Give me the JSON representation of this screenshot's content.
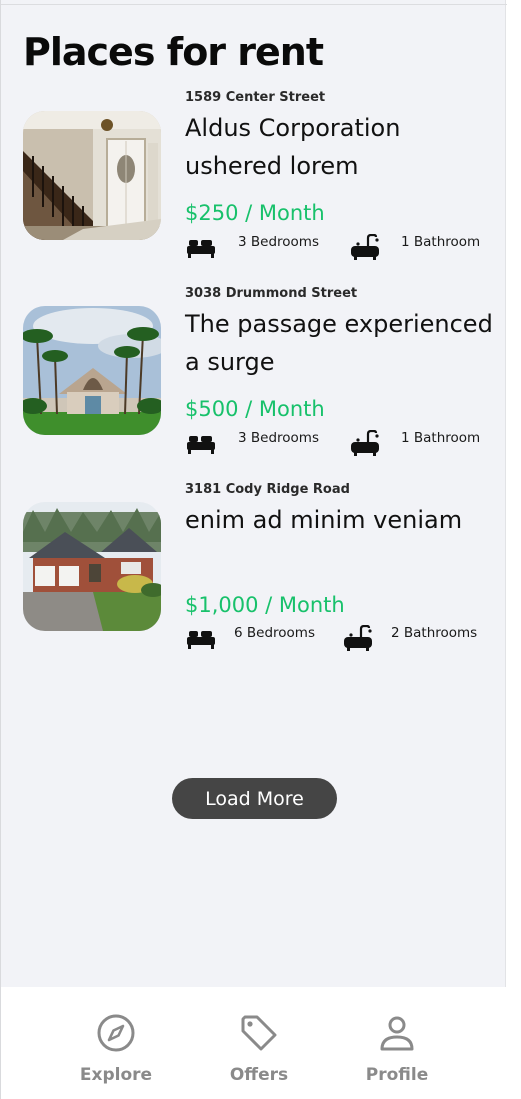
{
  "page": {
    "title": "Places for rent"
  },
  "listings": [
    {
      "address": "1589 Center Street",
      "name": "Aldus Corporation ushered lorem",
      "price": "$250 / Month",
      "bedrooms": "3 Bedrooms",
      "bathrooms": "1 Bathroom",
      "image": "house-interior-staircase-photo"
    },
    {
      "address": "3038 Drummond Street",
      "name": "The passage experienced a surge",
      "price": "$500 / Month",
      "bedrooms": "3 Bedrooms",
      "bathrooms": "1 Bathroom",
      "image": "house-with-palm-trees-photo"
    },
    {
      "address": "3181 Cody Ridge Road",
      "name": "enim ad minim veniam",
      "price": "$1,000 / Month",
      "bedrooms": "6 Bedrooms",
      "bathrooms": "2 Bathrooms",
      "image": "brick-house-garage-photo"
    }
  ],
  "load_more": "Load More",
  "nav": {
    "explore": "Explore",
    "offers": "Offers",
    "profile": "Profile"
  },
  "colors": {
    "price": "#18c16b",
    "button": "#454545",
    "nav_icon": "#8a8a8a",
    "background": "#f2f3f7"
  }
}
